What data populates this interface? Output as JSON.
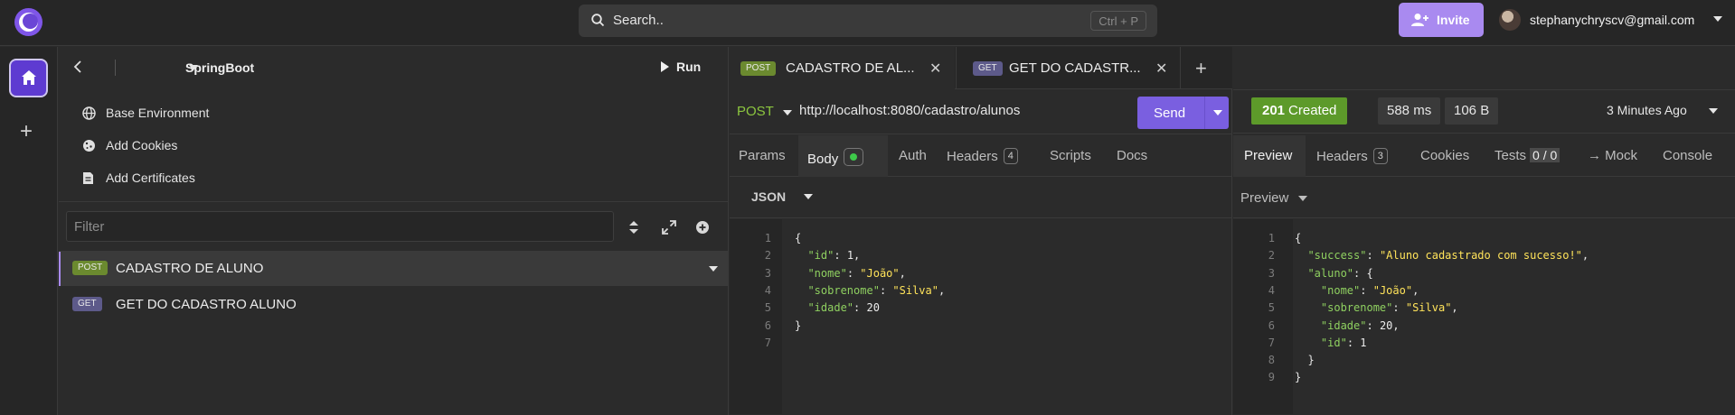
{
  "topbar": {
    "search_label": "Search..",
    "search_shortcut": "Ctrl + P",
    "invite_label": "Invite",
    "user_email": "stephanychryscv@gmail.com"
  },
  "sidebar": {
    "project_name": "SpringBoot",
    "run_label": "Run",
    "links": [
      {
        "label": "Base Environment",
        "icon": "globe-icon"
      },
      {
        "label": "Add Cookies",
        "icon": "cookie-icon"
      },
      {
        "label": "Add Certificates",
        "icon": "certificate-icon"
      }
    ],
    "filter_placeholder": "Filter",
    "requests": [
      {
        "method": "POST",
        "name": "CADASTRO DE ALUNO",
        "active": true
      },
      {
        "method": "GET",
        "name": "GET DO CADASTRO ALUNO",
        "active": false
      }
    ]
  },
  "request": {
    "tabs": [
      {
        "method": "POST",
        "name": "CADASTRO DE AL...",
        "active": true
      },
      {
        "method": "GET",
        "name": "GET DO CADASTR...",
        "active": false
      }
    ],
    "method": "POST",
    "url": "http://localhost:8080/cadastro/alunos",
    "send_label": "Send",
    "subtabs": {
      "params": "Params",
      "body": "Body",
      "auth": "Auth",
      "headers": "Headers",
      "headers_count": "4",
      "scripts": "Scripts",
      "docs": "Docs"
    },
    "body_type": "JSON",
    "body_lines": [
      {
        "n": "1",
        "text": "{"
      },
      {
        "n": "2",
        "key": "\"id\"",
        "val": "1",
        "type": "num",
        "comma": true
      },
      {
        "n": "3",
        "key": "\"nome\"",
        "val": "\"João\"",
        "type": "str",
        "comma": true
      },
      {
        "n": "4",
        "key": "\"sobrenome\"",
        "val": "\"Silva\"",
        "type": "str",
        "comma": true
      },
      {
        "n": "5",
        "key": "\"idade\"",
        "val": "20",
        "type": "num",
        "comma": false
      },
      {
        "n": "6",
        "text": "}"
      },
      {
        "n": "7",
        "text": ""
      }
    ]
  },
  "response": {
    "status_code": "201",
    "status_text": "Created",
    "time": "588 ms",
    "size": "106 B",
    "when": "3 Minutes Ago",
    "tabs": {
      "preview": "Preview",
      "headers": "Headers",
      "headers_count": "3",
      "cookies": "Cookies",
      "tests": "Tests",
      "tests_count": "0 / 0",
      "mock": "→ Mock",
      "console": "Console"
    },
    "preview_mode": "Preview",
    "body_lines": [
      {
        "n": "1",
        "text": "{"
      },
      {
        "n": "2",
        "indent": "  ",
        "key": "\"success\"",
        "val": "\"Aluno cadastrado com sucesso!\"",
        "type": "str",
        "comma": true
      },
      {
        "n": "3",
        "indent": "  ",
        "key": "\"aluno\"",
        "val": "{",
        "type": "punct",
        "comma": false
      },
      {
        "n": "4",
        "indent": "    ",
        "key": "\"nome\"",
        "val": "\"João\"",
        "type": "str",
        "comma": true
      },
      {
        "n": "5",
        "indent": "    ",
        "key": "\"sobrenome\"",
        "val": "\"Silva\"",
        "type": "str",
        "comma": true
      },
      {
        "n": "6",
        "indent": "    ",
        "key": "\"idade\"",
        "val": "20",
        "type": "num",
        "comma": true
      },
      {
        "n": "7",
        "indent": "    ",
        "key": "\"id\"",
        "val": "1",
        "type": "num",
        "comma": false
      },
      {
        "n": "8",
        "text": "  }"
      },
      {
        "n": "9",
        "text": "}"
      }
    ]
  }
}
